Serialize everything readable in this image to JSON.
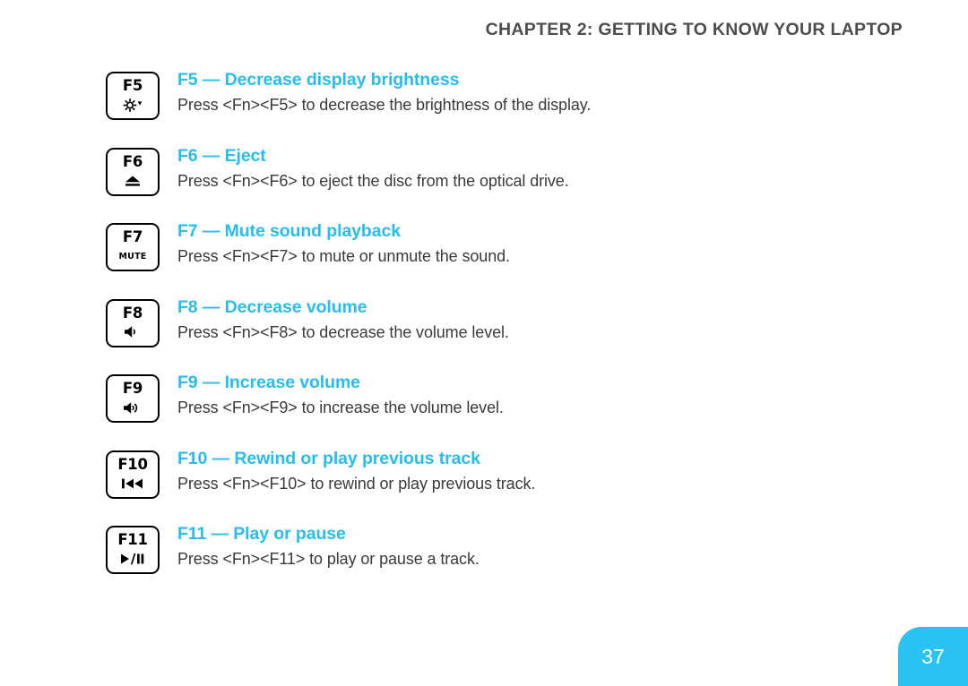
{
  "header": {
    "chapter_title": "CHAPTER 2: GETTING TO KNOW YOUR LAPTOP"
  },
  "colors": {
    "accent_cyan": "#27BDEF",
    "badge_cyan": "#2AC2F2",
    "header_gray": "#4d4d4d",
    "body_gray": "#3a3a3a",
    "keycap_border": "#000000"
  },
  "entries": [
    {
      "key_label": "F5",
      "icon": "brightness-decrease-icon",
      "icon_text": "",
      "title": "F5 — Decrease display brightness",
      "description": "Press <Fn><F5> to decrease the brightness of the display."
    },
    {
      "key_label": "F6",
      "icon": "eject-icon",
      "icon_text": "",
      "title": "F6 — Eject",
      "description": "Press <Fn><F6> to eject the disc from the optical drive."
    },
    {
      "key_label": "F7",
      "icon": "mute-text-icon",
      "icon_text": "MUTE",
      "title": "F7 — Mute sound playback",
      "description": "Press <Fn><F7> to mute or unmute the sound."
    },
    {
      "key_label": "F8",
      "icon": "speaker-low-icon",
      "icon_text": "",
      "title": "F8 — Decrease volume",
      "description": "Press <Fn><F8> to decrease the volume level."
    },
    {
      "key_label": "F9",
      "icon": "speaker-high-icon",
      "icon_text": "",
      "title": "F9 — Increase volume",
      "description": "Press <Fn><F9> to increase the volume level."
    },
    {
      "key_label": "F10",
      "icon": "rewind-previous-track-icon",
      "icon_text": "",
      "title": "F10 — Rewind or play previous track",
      "description": "Press <Fn><F10> to rewind or play previous track."
    },
    {
      "key_label": "F11",
      "icon": "play-pause-icon",
      "icon_text": "",
      "title": "F11 — Play or pause",
      "description": "Press <Fn><F11> to play or pause a track."
    }
  ],
  "footer": {
    "page_number": "37"
  }
}
